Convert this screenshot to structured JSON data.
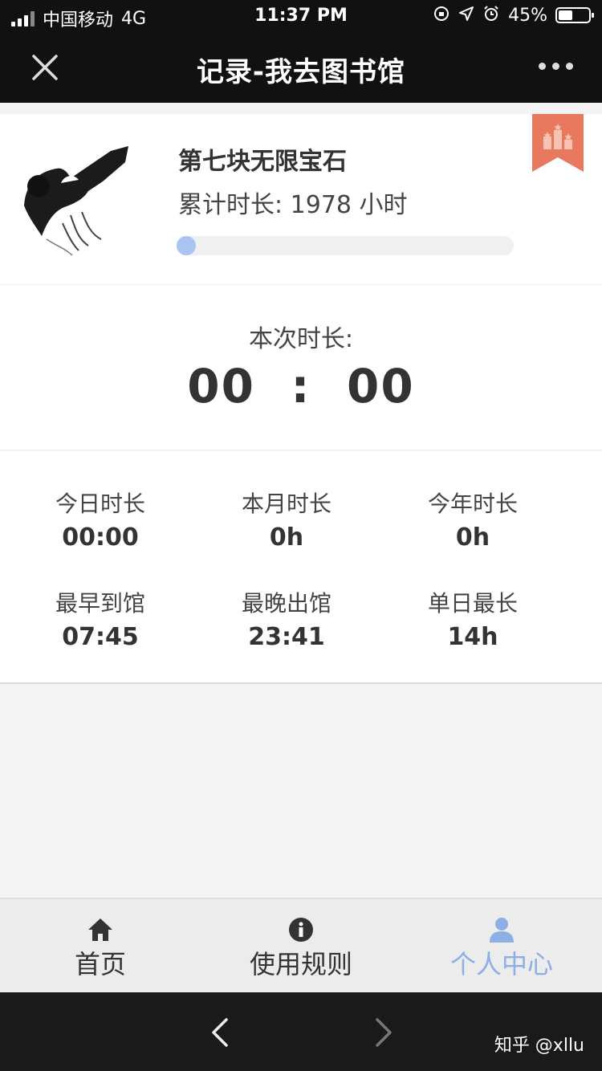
{
  "status_bar": {
    "carrier": "中国移动",
    "network": "4G",
    "time": "11:37 PM",
    "battery": "45%"
  },
  "nav": {
    "title": "记录-我去图书馆"
  },
  "profile": {
    "name": "第七块无限宝石",
    "total": "累计时长: 1978 小时",
    "progress": 0.03
  },
  "session": {
    "label": "本次时长:",
    "clock": "00  :  00"
  },
  "stats": [
    {
      "label": "今日时长",
      "value": "00:00"
    },
    {
      "label": "本月时长",
      "value": "0h"
    },
    {
      "label": "今年时长",
      "value": "0h"
    },
    {
      "label": "最早到馆",
      "value": "07:45"
    },
    {
      "label": "最晚出馆",
      "value": "23:41"
    },
    {
      "label": "单日最长",
      "value": "14h"
    }
  ],
  "tabs": [
    {
      "label": "首页",
      "icon": "home-icon"
    },
    {
      "label": "使用规则",
      "icon": "info-icon"
    },
    {
      "label": "个人中心",
      "icon": "user-icon"
    }
  ],
  "colors": {
    "accent": "#8eaee6",
    "badge": "#e8785e",
    "dark": "#111111"
  },
  "watermark": "知乎 @xllu"
}
